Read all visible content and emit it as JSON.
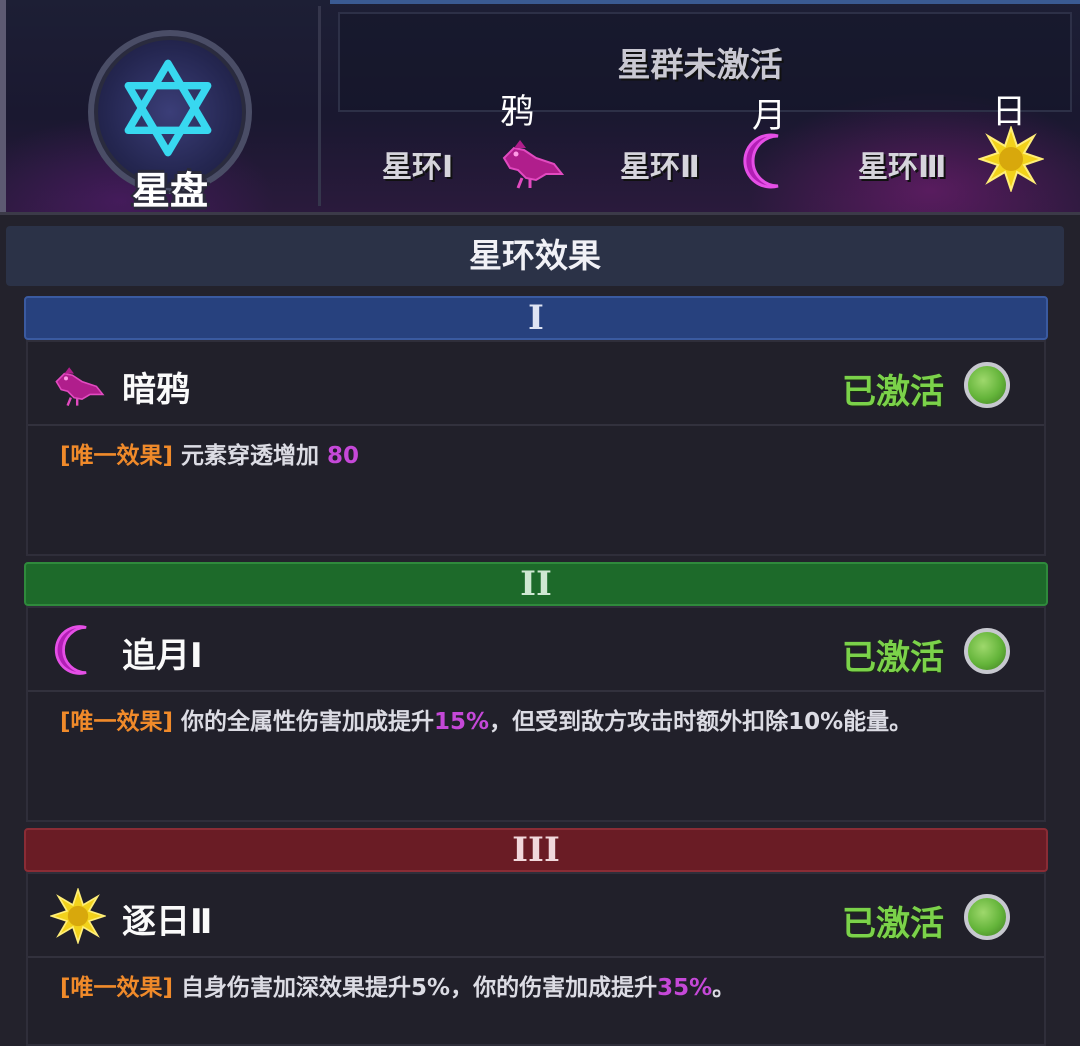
{
  "banner": {
    "disc_label": "星盘",
    "status": "星群未激活",
    "rings": [
      {
        "label": "星环Ⅰ",
        "caption": "鸦",
        "icon": "raven-icon"
      },
      {
        "label": "星环Ⅱ",
        "caption": "月",
        "icon": "crescent-moon-icon"
      },
      {
        "label": "星环Ⅲ",
        "caption": "日",
        "icon": "sun-icon"
      }
    ]
  },
  "effects": {
    "header": "星环效果",
    "sections": [
      {
        "tier": "I",
        "color": "#27417e",
        "name": "暗鸦",
        "icon": "raven-icon",
        "status": "已激活",
        "tag": "[唯一效果]",
        "desc_before": " 元素穿透增加 ",
        "highlight": "80",
        "desc_after": ""
      },
      {
        "tier": "II",
        "color": "#1d6a2a",
        "name": "追月Ⅰ",
        "icon": "crescent-moon-icon",
        "status": "已激活",
        "tag": "[唯一效果]",
        "desc_before": " 你的全属性伤害加成提升",
        "highlight": "15%",
        "desc_after": "，但受到敌方攻击时额外扣除10%能量。"
      },
      {
        "tier": "III",
        "color": "#6a1c25",
        "name": "逐日Ⅱ",
        "icon": "sun-icon",
        "status": "已激活",
        "tag": "[唯一效果]",
        "desc_before": " 自身伤害加深效果提升5%，你的伤害加成提升",
        "highlight": "35%",
        "desc_after": "。"
      }
    ]
  },
  "colors": {
    "active_green": "#7bd24a",
    "tag_orange": "#f08a2a",
    "highlight_purple": "#c548d8"
  }
}
